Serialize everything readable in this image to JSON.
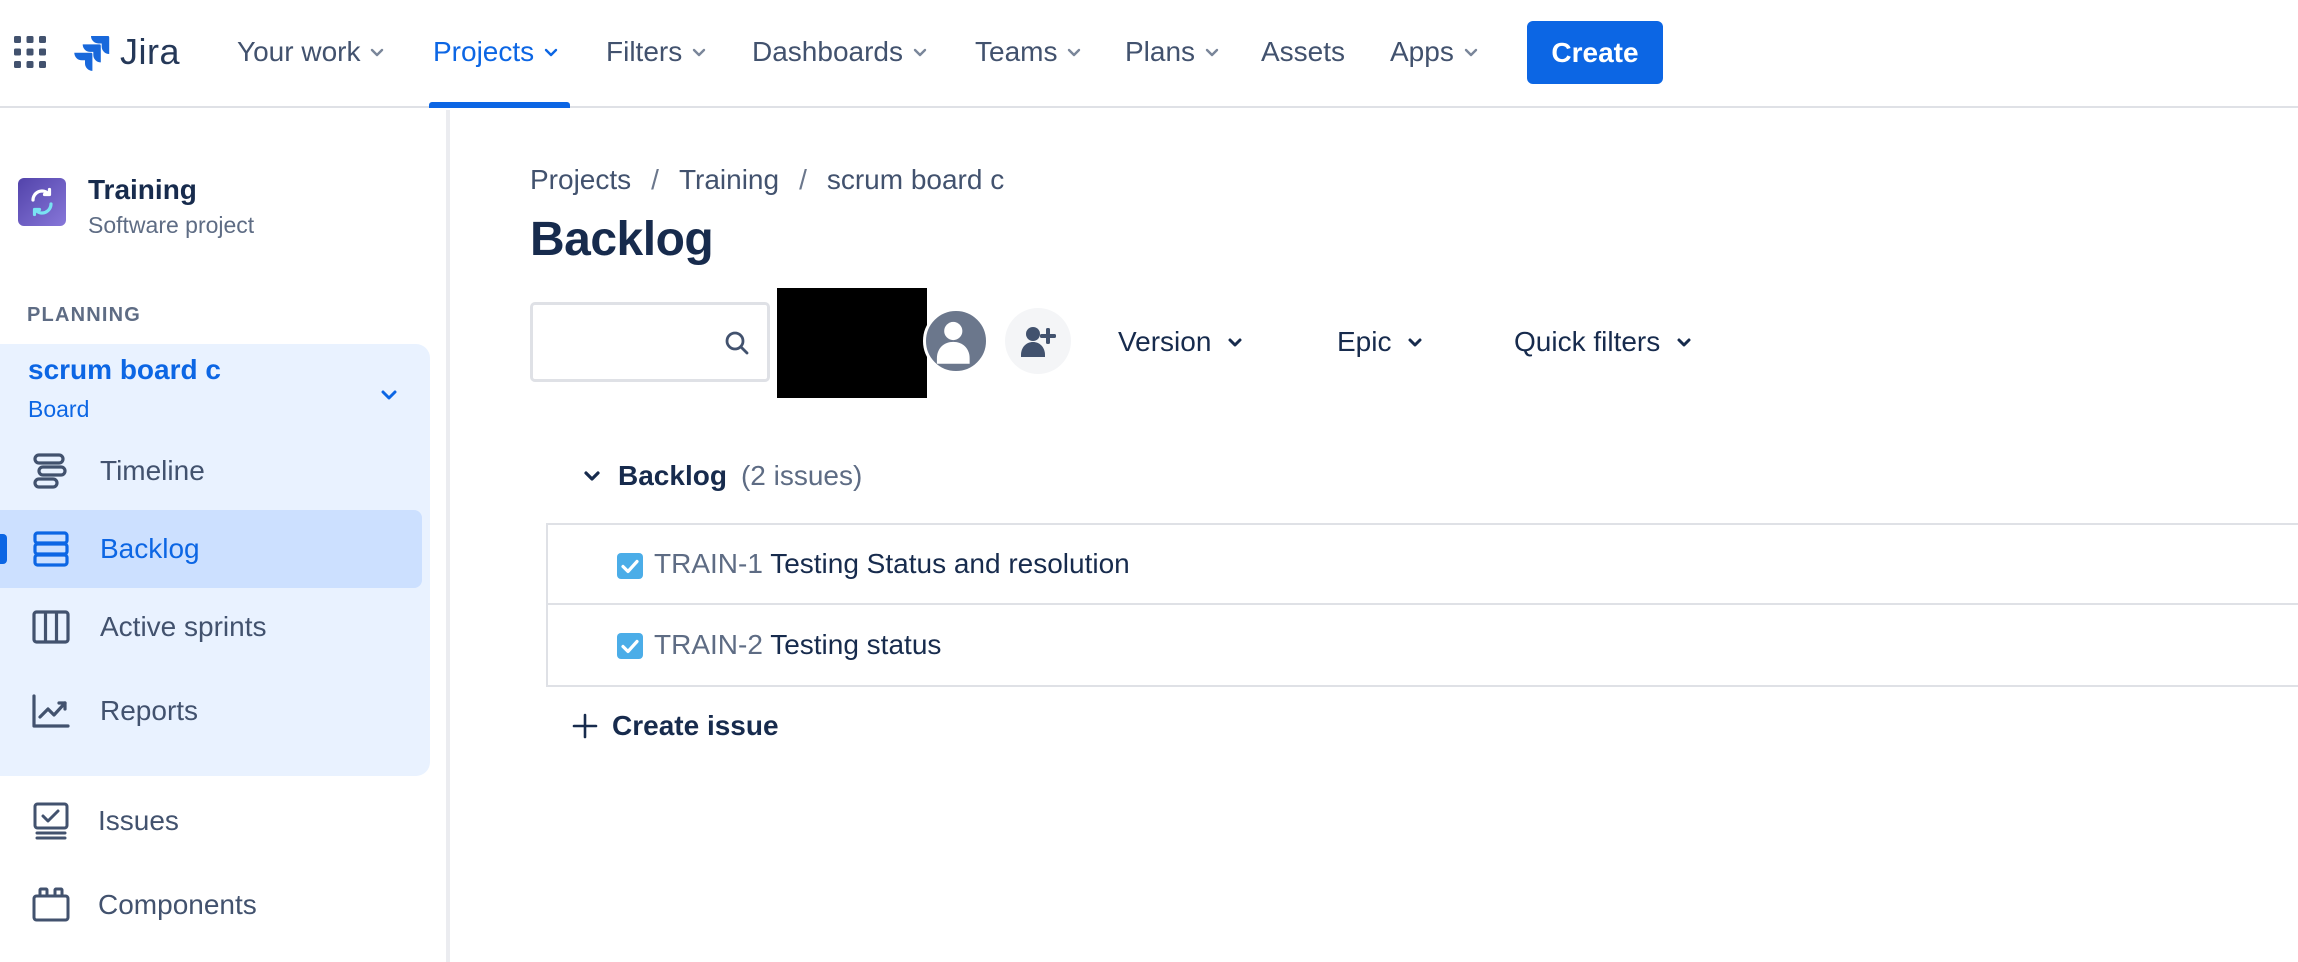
{
  "app": {
    "name": "Jira"
  },
  "topnav": {
    "items": [
      {
        "label": "Your work",
        "has_chevron": true
      },
      {
        "label": "Projects",
        "has_chevron": true,
        "active": true
      },
      {
        "label": "Filters",
        "has_chevron": true
      },
      {
        "label": "Dashboards",
        "has_chevron": true
      },
      {
        "label": "Teams",
        "has_chevron": true
      },
      {
        "label": "Plans",
        "has_chevron": true
      },
      {
        "label": "Assets",
        "has_chevron": false
      },
      {
        "label": "Apps",
        "has_chevron": true
      }
    ],
    "create_label": "Create",
    "accent_color": "#0C66E4"
  },
  "sidebar": {
    "project": {
      "name": "Training",
      "type": "Software project",
      "icon": "project-sync-icon"
    },
    "section_label": "PLANNING",
    "board": {
      "name": "scrum board c",
      "sub": "Board"
    },
    "items": [
      {
        "label": "Timeline",
        "icon": "timeline-icon"
      },
      {
        "label": "Backlog",
        "icon": "backlog-icon",
        "selected": true
      },
      {
        "label": "Active sprints",
        "icon": "board-columns-icon"
      },
      {
        "label": "Reports",
        "icon": "reports-chart-icon"
      }
    ],
    "extra_items": [
      {
        "label": "Issues",
        "icon": "issues-icon"
      },
      {
        "label": "Components",
        "icon": "components-icon"
      }
    ]
  },
  "main": {
    "breadcrumb": [
      "Projects",
      "Training",
      "scrum board c"
    ],
    "breadcrumb_sep": "/",
    "title": "Backlog",
    "search": {
      "value": "",
      "placeholder": ""
    },
    "filters": {
      "version": "Version",
      "epic": "Epic",
      "quick": "Quick filters"
    },
    "backlog": {
      "title": "Backlog",
      "count": "(2 issues)",
      "issues": [
        {
          "key": "TRAIN-1",
          "summary": "Testing Status and resolution",
          "type": "task"
        },
        {
          "key": "TRAIN-2",
          "summary": "Testing status",
          "type": "task"
        }
      ],
      "create_label": "Create issue"
    }
  }
}
